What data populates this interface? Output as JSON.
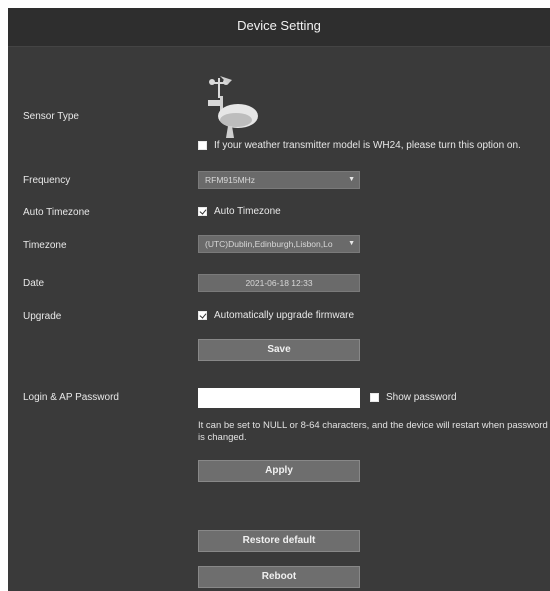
{
  "header": {
    "title": "Device Setting"
  },
  "sensor": {
    "label": "Sensor Type",
    "icon": "weather-station-icon",
    "wh24_checked": false,
    "wh24_text": "If your weather transmitter model is WH24, please turn this option on."
  },
  "frequency": {
    "label": "Frequency",
    "value": "RFM915MHz"
  },
  "auto_timezone": {
    "label": "Auto Timezone",
    "checked": true,
    "text": "Auto Timezone"
  },
  "timezone": {
    "label": "Timezone",
    "value": "(UTC)Dublin,Edinburgh,Lisbon,Lo"
  },
  "date": {
    "label": "Date",
    "value": "2021-06-18 12:33"
  },
  "upgrade": {
    "label": "Upgrade",
    "checked": true,
    "text": "Automatically upgrade firmware"
  },
  "save_button": "Save",
  "password": {
    "label": "Login & AP Password",
    "value": "",
    "show_checked": false,
    "show_text": "Show password",
    "note": "It can be set to NULL or 8-64 characters, and the device will restart when password is changed."
  },
  "apply_button": "Apply",
  "restore_button": "Restore default",
  "reboot_button": "Reboot",
  "colors": {
    "background": "#3a3a3a",
    "header": "#2e2e2e",
    "button": "#6e6e6e"
  }
}
